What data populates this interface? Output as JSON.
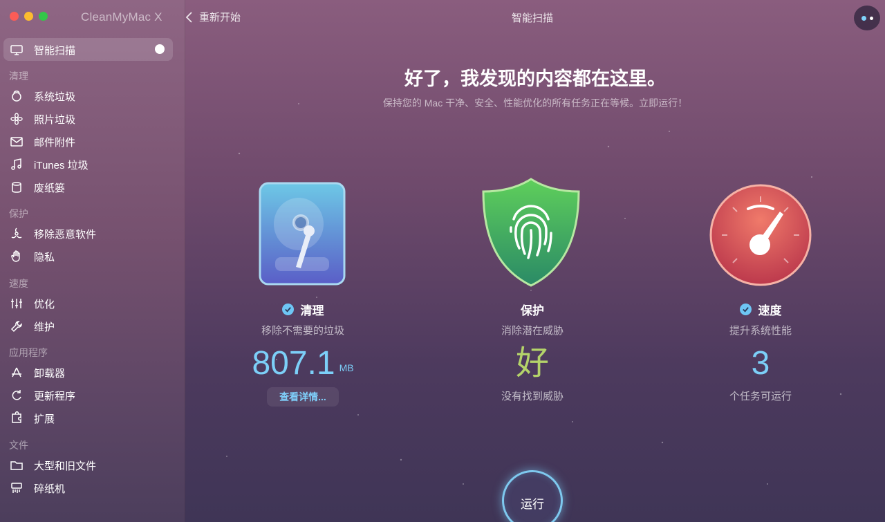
{
  "app": {
    "title": "CleanMyMac X"
  },
  "topbar": {
    "back_label": "重新开始",
    "title": "智能扫描"
  },
  "sidebar": {
    "smart_scan": "智能扫描",
    "sections": [
      {
        "label": "清理",
        "items": [
          "系统垃圾",
          "照片垃圾",
          "邮件附件",
          "iTunes 垃圾",
          "废纸篓"
        ]
      },
      {
        "label": "保护",
        "items": [
          "移除恶意软件",
          "隐私"
        ]
      },
      {
        "label": "速度",
        "items": [
          "优化",
          "维护"
        ]
      },
      {
        "label": "应用程序",
        "items": [
          "卸载器",
          "更新程序",
          "扩展"
        ]
      },
      {
        "label": "文件",
        "items": [
          "大型和旧文件",
          "碎纸机"
        ]
      }
    ]
  },
  "main": {
    "headline": "好了，我发现的内容都在这里。",
    "subline": "保持您的 Mac 干净、安全、性能优化的所有任务正在等候。立即运行！",
    "cards": [
      {
        "title": "清理",
        "desc": "移除不需要的垃圾",
        "value": "807.1",
        "unit": "MB",
        "action": "查看详情..."
      },
      {
        "title": "保护",
        "desc": "消除潜在威胁",
        "value": "好",
        "footer": "没有找到威胁"
      },
      {
        "title": "速度",
        "desc": "提升系统性能",
        "value": "3",
        "footer": "个任务可运行"
      }
    ],
    "run_label": "运行"
  },
  "colors": {
    "accent_blue": "#6ec6f5",
    "good_green": "#b4d36a",
    "run_ring": "#7ec9ef"
  },
  "icons": {
    "clean": "hard-drive-icon",
    "protect": "fingerprint-shield-icon",
    "speed": "speedometer-icon"
  }
}
